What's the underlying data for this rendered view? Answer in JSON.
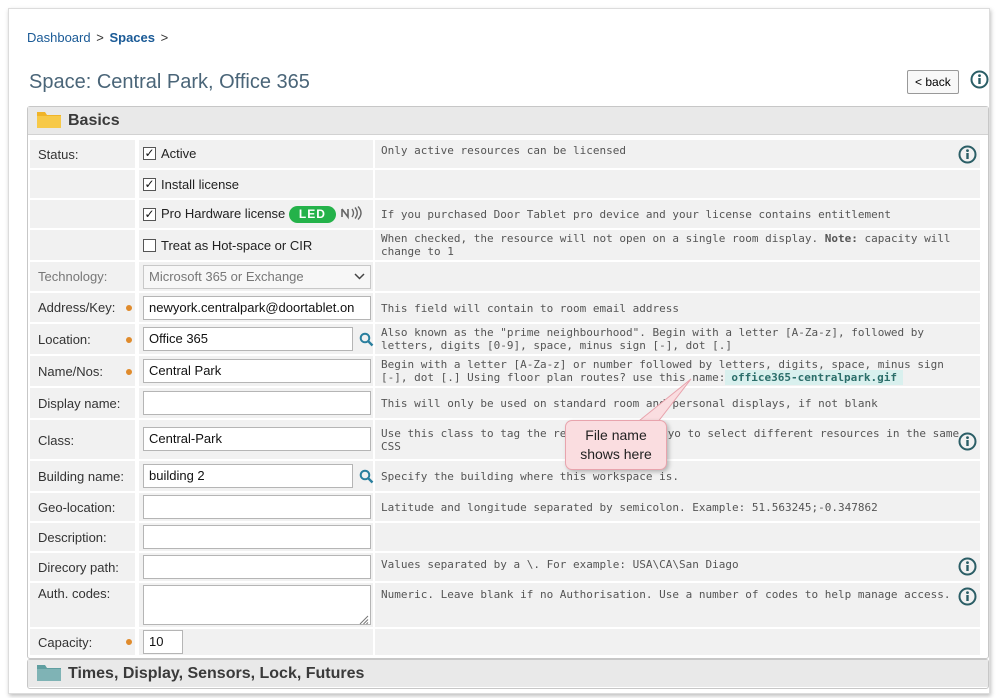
{
  "breadcrumb": {
    "items": [
      "Dashboard",
      "Spaces"
    ],
    "separator": ">"
  },
  "page_title": "Space: Central Park, Office 365",
  "back_label": "< back",
  "sections": {
    "basics": "Basics",
    "times": "Times, Display, Sensors, Lock, Futures"
  },
  "status": {
    "label": "Status:",
    "active_label": "Active",
    "active_help": "Only active resources can be licensed",
    "install_label": "Install license",
    "pro_label": "Pro Hardware license",
    "led_badge": "LED",
    "pro_help": "If you purchased Door Tablet pro device and your license contains entitlement",
    "hot_label": "Treat as Hot-space or CIR",
    "hot_help_1": "When checked, the resource will not open on a single room display.  ",
    "hot_help_note": "Note:",
    "hot_help_2": " capacity will change to 1"
  },
  "technology": {
    "label": "Technology:",
    "value": "Microsoft 365 or Exchange"
  },
  "address": {
    "label": "Address/Key:",
    "value": "newyork.centralpark@doortablet.on",
    "help": "This field will contain to room email address"
  },
  "location": {
    "label": "Location:",
    "value": "Office 365",
    "help": "Also known as the \"prime neighbourhood\". Begin with a letter [A-Za-z], followed by letters, digits [0-9], space, minus sign [-], dot [.]"
  },
  "name": {
    "label": "Name/Nos:",
    "value": "Central Park",
    "help_1": "Begin with a letter [A-Za-z] or number followed by letters, digits, space, minus sign [-], dot [.]  Using floor plan routes? use this name:",
    "filename": "office365-centralpark.gif"
  },
  "display_name": {
    "label": "Display name:",
    "value": "",
    "help": "This will only be used on standard room and personal displays, if not blank"
  },
  "class": {
    "label": "Class:",
    "value": "Central-Park",
    "help_1": "Use this class to tag the reso",
    "help_2": "yo to select different resources in the same CSS"
  },
  "building": {
    "label": "Building name:",
    "value": "building 2",
    "help": "Specify the building where this workspace is."
  },
  "geo": {
    "label": "Geo-location:",
    "value": "",
    "help": "Latitude and longitude separated by semicolon.  Example: 51.563245;-0.347862"
  },
  "description": {
    "label": "Description:",
    "value": ""
  },
  "directory": {
    "label": "Direcory path:",
    "value": "",
    "help": "Values separated by a \\.  For example: USA\\CA\\San Diago"
  },
  "auth": {
    "label": "Auth. codes:",
    "value": "",
    "help": "Numeric. Leave blank if no Authorisation. Use a number of codes to help manage access."
  },
  "capacity": {
    "label": "Capacity:",
    "value": "10"
  },
  "callout": {
    "line1": "File name",
    "line2": "shows here"
  },
  "colors": {
    "accent": "#1a5a96",
    "info": "#2b5e66",
    "required": "#e08b2c",
    "led": "#24b24a"
  }
}
